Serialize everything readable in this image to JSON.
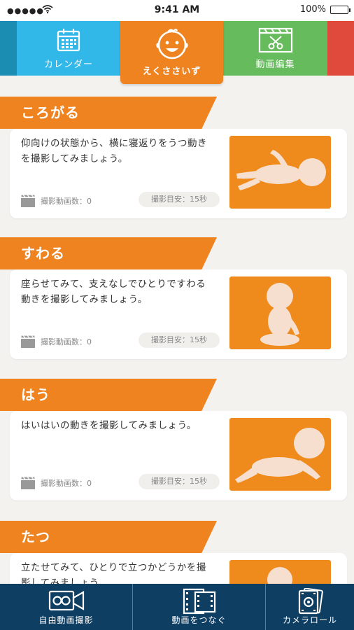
{
  "status_bar": {
    "signal": "●●●●●",
    "time": "9:41 AM",
    "battery": "100%",
    "battery_level": 1.0
  },
  "tabs": [
    {
      "label": "カレンダー",
      "icon": "calendar-icon",
      "color": "#31b8e9"
    },
    {
      "label": "えくささいず",
      "icon": "baby-face-icon",
      "color": "#ee8320",
      "selected": true
    },
    {
      "label": "動画編集",
      "icon": "video-edit-icon",
      "color": "#66bb5d"
    }
  ],
  "sections": [
    {
      "title": "ころがる",
      "description": "仰向けの状態から、横に寝返りをうつ動きを撮影してみましょう。",
      "video_count": "撮影動画数：0",
      "guide": "撮影目安：15秒"
    },
    {
      "title": "すわる",
      "description": "座らせてみて、支えなしでひとりですわる動きを撮影してみましょう。",
      "video_count": "撮影動画数：0",
      "guide": "撮影目安：15秒"
    },
    {
      "title": "はう",
      "description": "はいはいの動きを撮影してみましょう。",
      "video_count": "撮影動画数：0",
      "guide": "撮影目安：15秒"
    },
    {
      "title": "たつ",
      "description": "立たせてみて、ひとりで立つかどうかを撮影してみましょう。",
      "video_count": "",
      "guide": ""
    }
  ],
  "bottom_nav": [
    {
      "label": "自由動画撮影",
      "icon": "video-camera-icon"
    },
    {
      "label": "動画をつなぐ",
      "icon": "film-strip-icon"
    },
    {
      "label": "カメラロール",
      "icon": "camera-roll-icon"
    }
  ],
  "colors": {
    "accent_orange": "#ee8320",
    "calendar_blue": "#31b8e9",
    "edit_green": "#66bb5d",
    "nav_navy": "#0f3e63"
  }
}
